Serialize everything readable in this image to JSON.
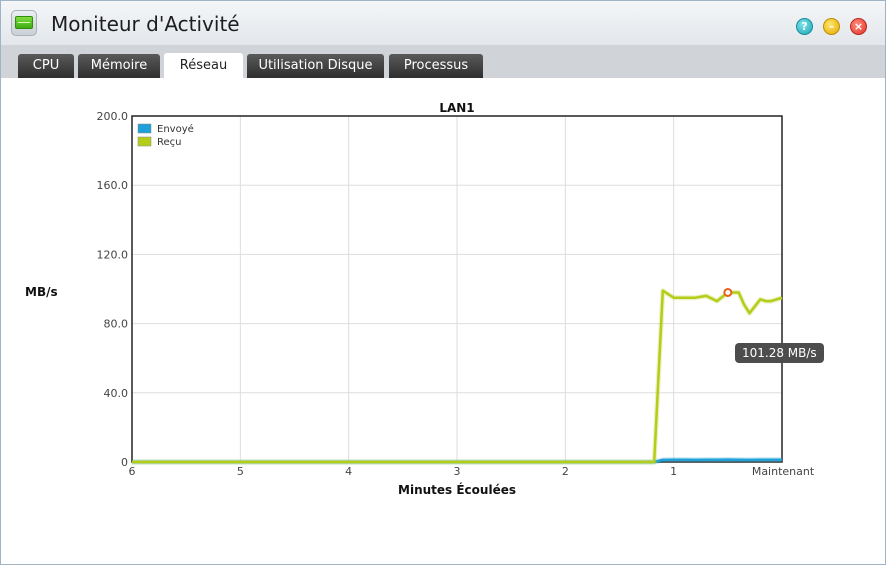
{
  "window": {
    "title": "Moniteur d'Activité",
    "icons": {
      "app": "activity-monitor-icon",
      "help": "help-icon",
      "minimize": "minimize-icon",
      "close": "close-icon"
    },
    "colors": {
      "help": "#1ba7b6",
      "minimize": "#e3a900",
      "close": "#e0352b"
    }
  },
  "tabs": [
    {
      "label": "CPU",
      "active": false
    },
    {
      "label": "Mémoire",
      "active": false
    },
    {
      "label": "Réseau",
      "active": true
    },
    {
      "label": "Utilisation Disque",
      "active": false
    },
    {
      "label": "Processus",
      "active": false
    }
  ],
  "tooltip": {
    "text": "101.28 MB/s"
  },
  "chart_data": {
    "type": "line",
    "title": "LAN1",
    "xlabel": "Minutes Écoulées",
    "ylabel": "MB/s",
    "xlim": [
      6,
      0
    ],
    "ylim": [
      0,
      200
    ],
    "x_ticks": [
      {
        "value": 6,
        "label": "6"
      },
      {
        "value": 5,
        "label": "5"
      },
      {
        "value": 4,
        "label": "4"
      },
      {
        "value": 3,
        "label": "3"
      },
      {
        "value": 2,
        "label": "2"
      },
      {
        "value": 1,
        "label": "1"
      },
      {
        "value": 0,
        "label": "Maintenant"
      }
    ],
    "y_ticks": [
      {
        "value": 0,
        "label": "0"
      },
      {
        "value": 40,
        "label": "40.0"
      },
      {
        "value": 80,
        "label": "80.0"
      },
      {
        "value": 120,
        "label": "120.0"
      },
      {
        "value": 160,
        "label": "160.0"
      },
      {
        "value": 200,
        "label": "200.0"
      }
    ],
    "grid": true,
    "legend_position": "top-left",
    "series": [
      {
        "name": "Envoyé",
        "color": "#1fa0d8",
        "x": [
          6,
          1.18,
          1.1,
          1,
          0.9,
          0.8,
          0.7,
          0.6,
          0.5,
          0.4,
          0.3,
          0.2,
          0.1,
          0
        ],
        "y": [
          0,
          0,
          1.2,
          1.3,
          1.3,
          1.2,
          1.3,
          1.3,
          1.4,
          1.3,
          1.2,
          1.3,
          1.3,
          1.3
        ]
      },
      {
        "name": "Reçu",
        "color": "#b5cc18",
        "x": [
          6,
          1.18,
          1.1,
          1,
          0.9,
          0.8,
          0.7,
          0.6,
          0.5,
          0.4,
          0.35,
          0.3,
          0.25,
          0.2,
          0.15,
          0.1,
          0
        ],
        "y": [
          0,
          0,
          99,
          95,
          95,
          95,
          96,
          93,
          98,
          98,
          91,
          86,
          90,
          94,
          93,
          93,
          95
        ]
      }
    ],
    "highlight": {
      "series": "Reçu",
      "x": 0.5,
      "y": 98
    }
  }
}
